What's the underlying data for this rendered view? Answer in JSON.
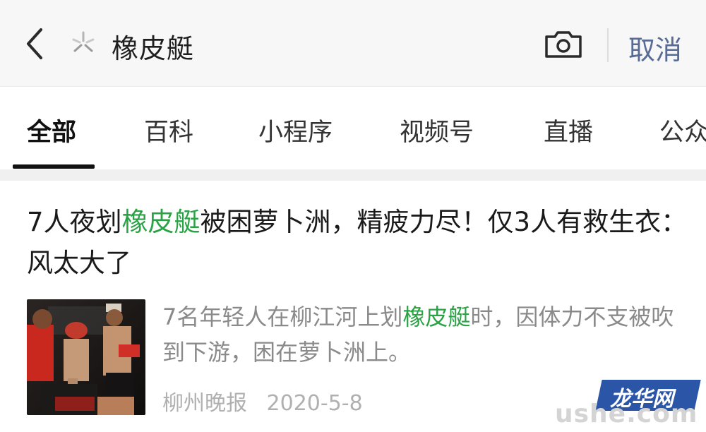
{
  "header": {
    "search_query": "橡皮艇",
    "cancel_label": "取消"
  },
  "tabs": [
    {
      "label": "全部",
      "active": true
    },
    {
      "label": "百科"
    },
    {
      "label": "小程序"
    },
    {
      "label": "视频号"
    },
    {
      "label": "直播"
    },
    {
      "label": "公众号"
    }
  ],
  "result": {
    "title_parts": {
      "pre": "7人夜划",
      "highlight": "橡皮艇",
      "post": "被困萝卜洲，精疲力尽！仅3人有救生衣：风太大了"
    },
    "snippet_parts": {
      "pre": "7名年轻人在柳江河上划",
      "highlight": "橡皮艇",
      "post": "时，因体力不支被吹到下游，困在萝卜洲上。"
    },
    "source": "柳州晚报",
    "date": "2020-5-8"
  },
  "watermark": {
    "badge": "龙华网",
    "domain": "ushe.com"
  },
  "colors": {
    "highlight": "#2ba245",
    "cancel": "#576b95",
    "watermark_badge": "#2b56a8"
  },
  "icons": {
    "back": "chevron-left-icon",
    "search_logo": "sparkle-icon",
    "camera": "camera-icon"
  }
}
